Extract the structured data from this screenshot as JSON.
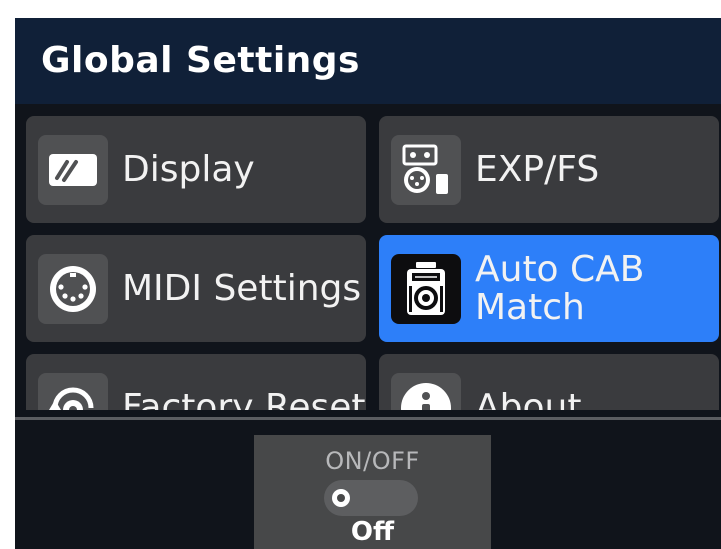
{
  "header": {
    "title": "Global Settings"
  },
  "tiles": [
    {
      "label": "Display",
      "icon": "display-icon",
      "selected": false
    },
    {
      "label": "EXP/FS",
      "icon": "exp-fs-icon",
      "selected": false
    },
    {
      "label": "MIDI Settings",
      "icon": "midi-icon",
      "selected": false
    },
    {
      "label": "Auto CAB\nMatch",
      "icon": "cab-speaker-icon",
      "selected": true
    },
    {
      "label": "Factory Reset",
      "icon": "factory-reset-icon",
      "selected": false
    },
    {
      "label": "About",
      "icon": "info-icon",
      "selected": false
    }
  ],
  "footer": {
    "label": "ON/OFF",
    "state": "Off",
    "toggle_on": false
  },
  "colors": {
    "accent": "#2d7ff9",
    "header": "#102038",
    "tile": "#3a3b3e"
  }
}
